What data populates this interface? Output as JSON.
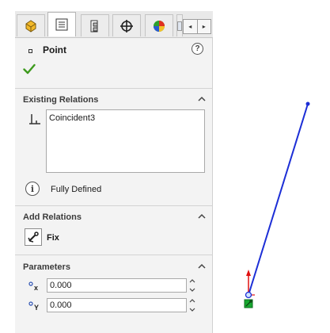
{
  "tabs": [
    {
      "name": "feature-manager-tab",
      "icon": "feature-manager-icon"
    },
    {
      "name": "property-manager-tab",
      "icon": "property-manager-icon",
      "active": true
    },
    {
      "name": "configuration-manager-tab",
      "icon": "configuration-manager-icon"
    },
    {
      "name": "dimxpert-manager-tab",
      "icon": "dimxpert-crosshair-icon"
    },
    {
      "name": "display-manager-tab",
      "icon": "display-manager-icon"
    },
    {
      "name": "tab-overflow",
      "icon": "overflow-tab-icon"
    }
  ],
  "header": {
    "bullet_icon": "square-bullet-icon",
    "title": "Point",
    "help": "?",
    "ok_icon": "green-checkmark-icon"
  },
  "existing_relations": {
    "heading": "Existing Relations",
    "relations": [
      "Coincident3"
    ],
    "status": "Fully Defined"
  },
  "add_relations": {
    "heading": "Add Relations",
    "fix_label": "Fix"
  },
  "parameters": {
    "heading": "Parameters",
    "x_value": "0.000",
    "y_value": "0.000"
  },
  "colors": {
    "line": "#1c2ed6",
    "axis_y": "#e01010",
    "origin_marker": "#17a82f",
    "check": "#3d9a1d"
  }
}
